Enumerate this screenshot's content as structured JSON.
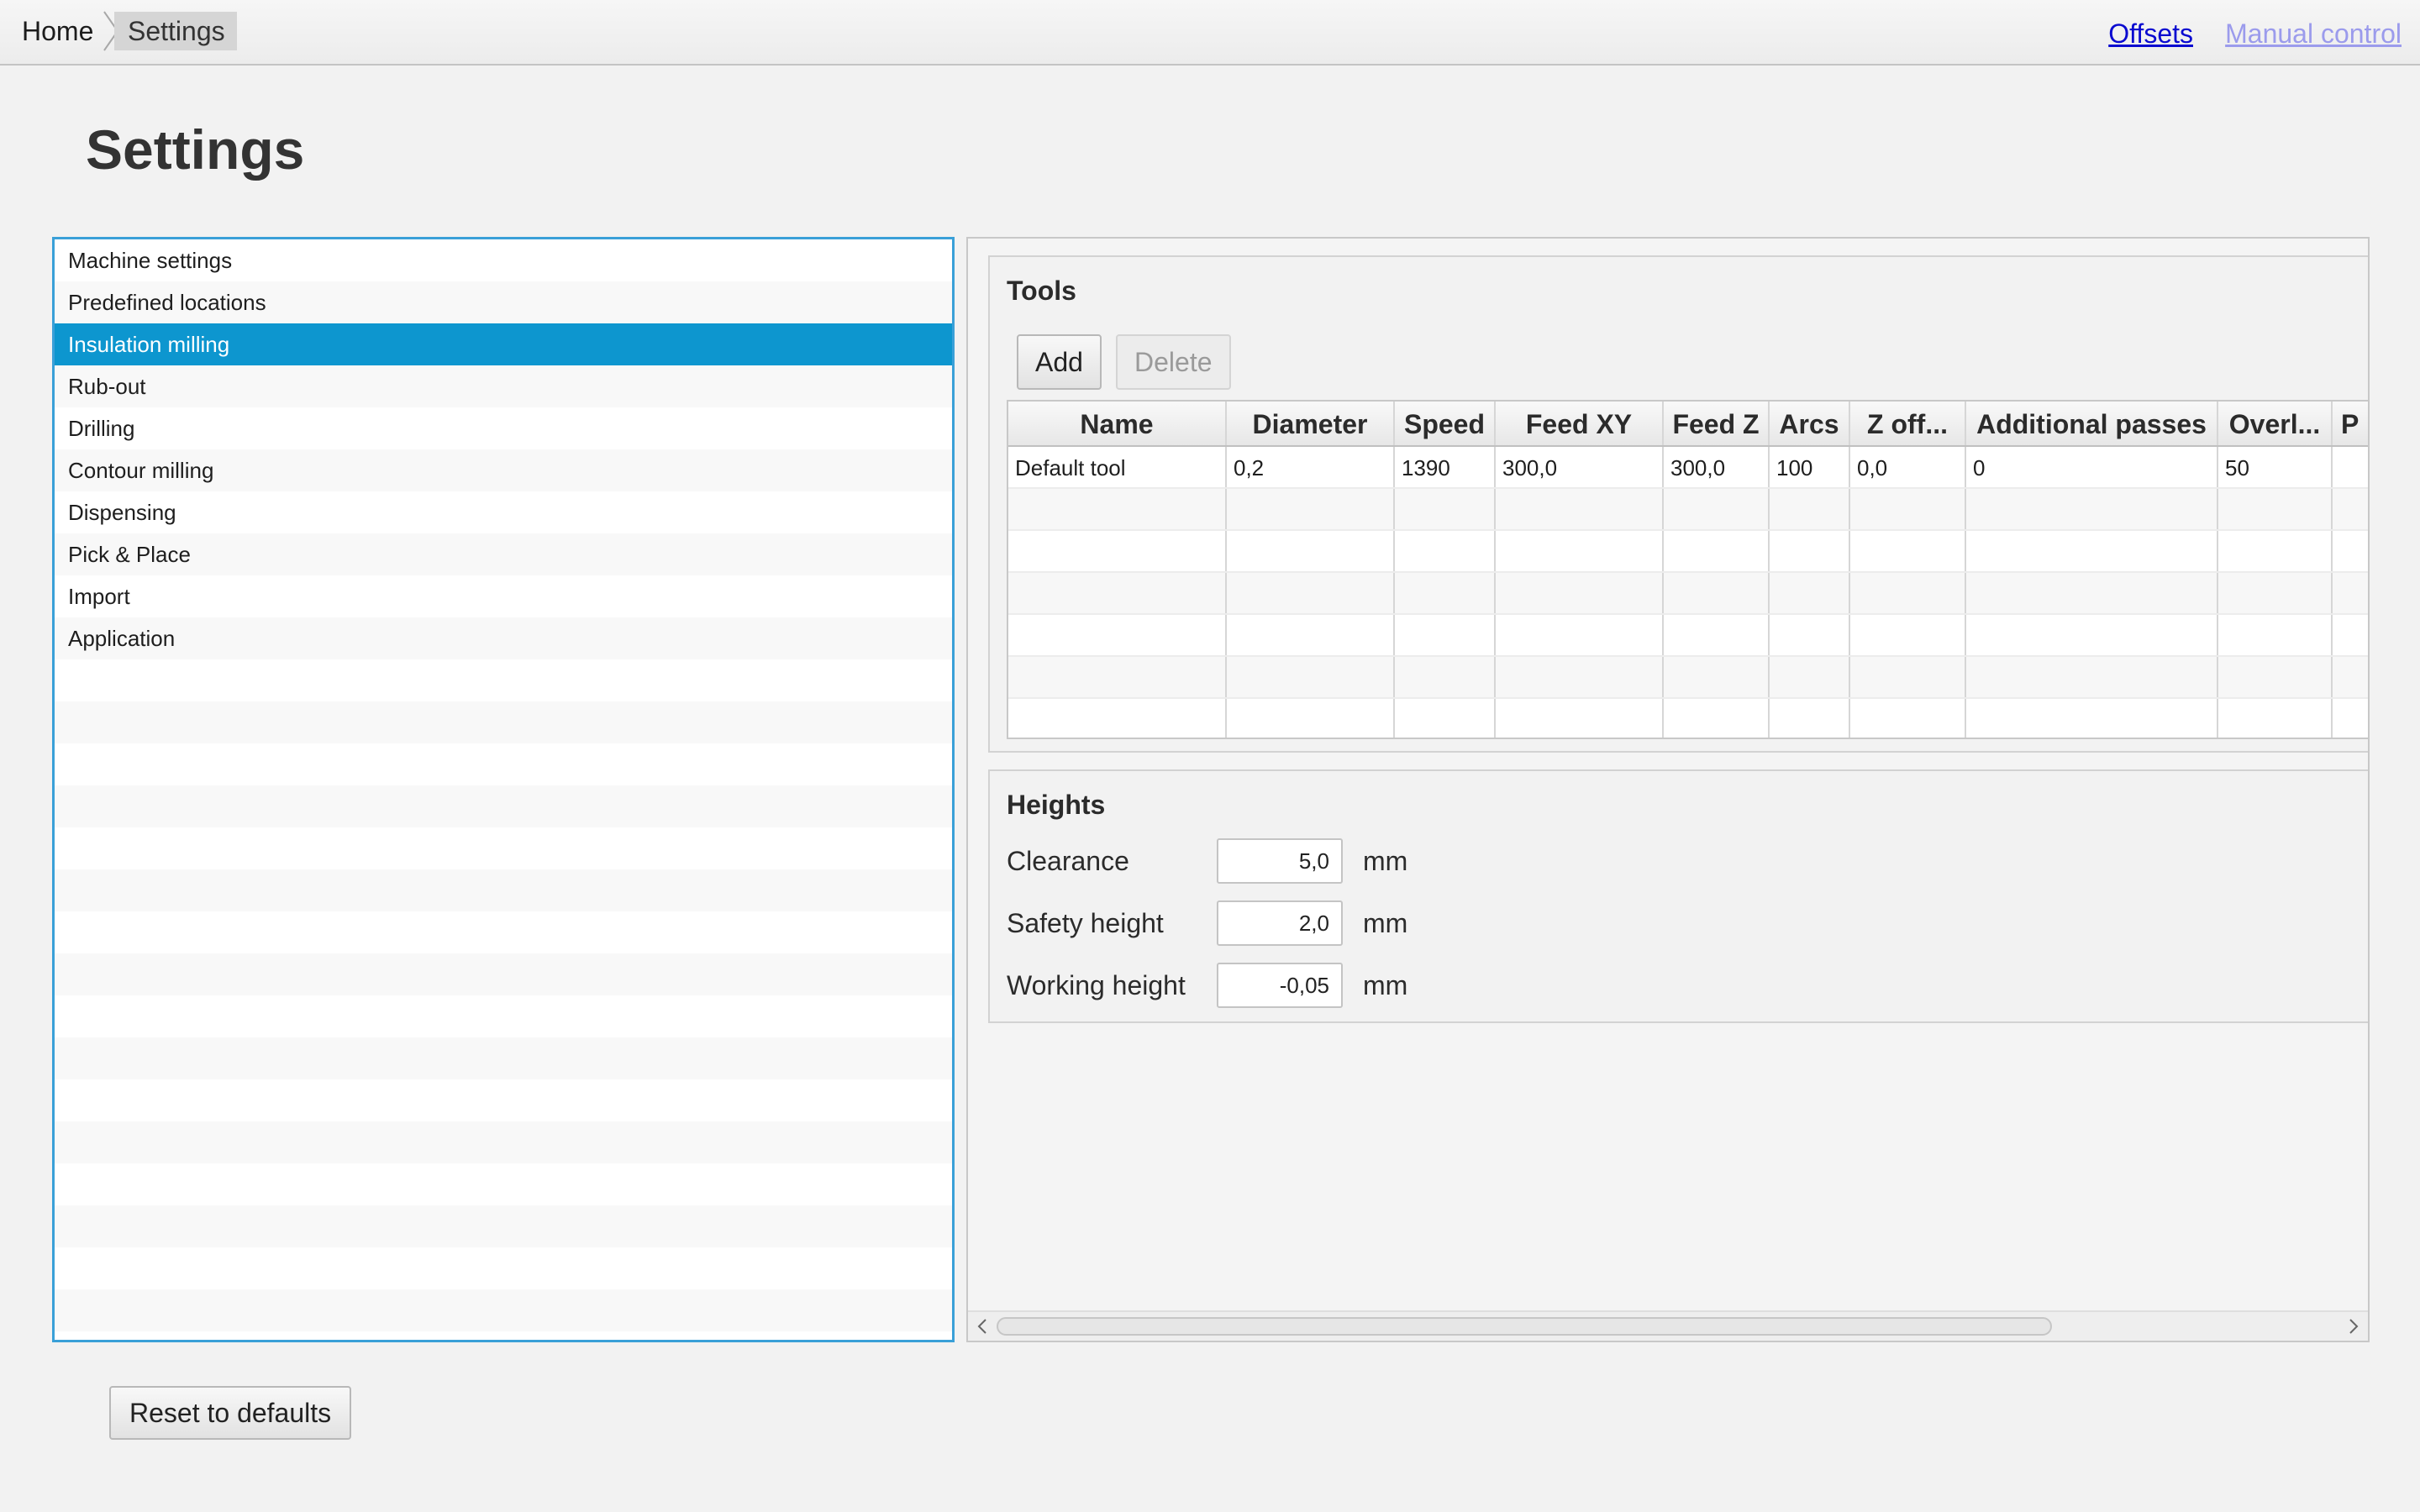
{
  "breadcrumb": {
    "home": "Home",
    "current": "Settings"
  },
  "header_links": {
    "offsets": "Offsets",
    "manual_control": "Manual control"
  },
  "page_title": "Settings",
  "nav": {
    "items": [
      {
        "label": "Machine settings"
      },
      {
        "label": "Predefined locations"
      },
      {
        "label": "Insulation milling"
      },
      {
        "label": "Rub-out"
      },
      {
        "label": "Drilling"
      },
      {
        "label": "Contour milling"
      },
      {
        "label": "Dispensing"
      },
      {
        "label": "Pick & Place"
      },
      {
        "label": "Import"
      },
      {
        "label": "Application"
      }
    ],
    "selected_index": 2
  },
  "tools": {
    "title": "Tools",
    "add_label": "Add",
    "delete_label": "Delete",
    "columns": [
      "Name",
      "Diameter",
      "Speed",
      "Feed XY",
      "Feed Z",
      "Arcs",
      "Z off...",
      "Additional passes",
      "Overl...",
      "P"
    ],
    "rows": [
      [
        "Default tool",
        "0,2",
        "1390",
        "300,0",
        "300,0",
        "100",
        "0,0",
        "0",
        "50",
        ""
      ]
    ]
  },
  "heights": {
    "title": "Heights",
    "fields": [
      {
        "label": "Clearance",
        "value": "5,0",
        "unit": "mm"
      },
      {
        "label": "Safety height",
        "value": "2,0",
        "unit": "mm"
      },
      {
        "label": "Working height",
        "value": "-0,05",
        "unit": "mm"
      }
    ]
  },
  "reset_label": "Reset to defaults",
  "colors": {
    "selection": "#0d96cf",
    "focus_border": "#3aa0d8",
    "link": "#0a0ad0",
    "link_visited": "#9b9bec"
  }
}
